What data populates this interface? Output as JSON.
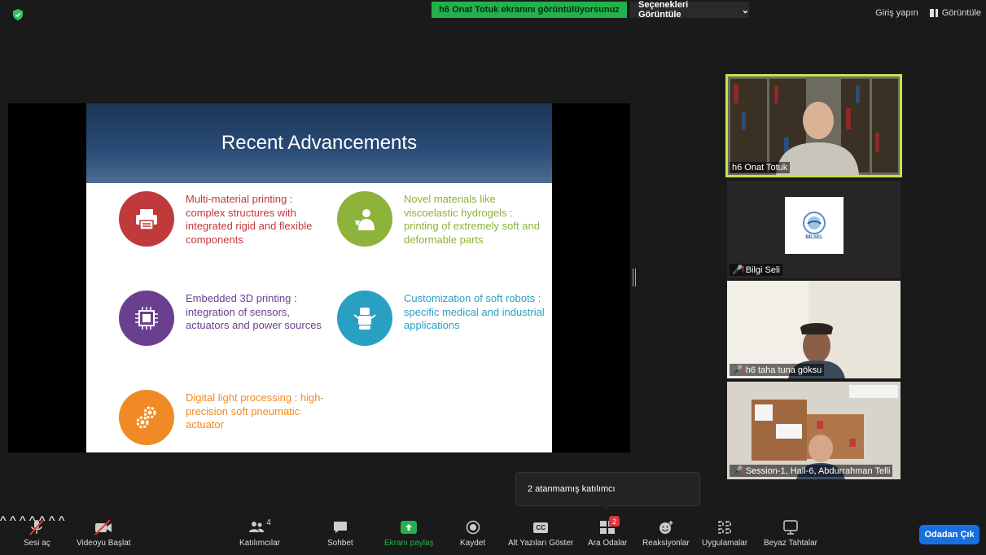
{
  "top": {
    "share_banner": "h6 Onat Totuk ekranını görüntülüyorsunuz",
    "view_options": "Seçenekleri Görüntüle",
    "sign_in": "Giriş yapın",
    "view": "Görüntüle"
  },
  "slide": {
    "title": "Recent Advancements",
    "items": [
      {
        "text": "Multi-material printing : complex structures with integrated rigid and flexible components",
        "color": "#c0393b",
        "icon": "printer-icon"
      },
      {
        "text": "Novel materials like viscoelastic hydrogels : printing of extremely soft and deformable parts",
        "color": "#8db33a",
        "icon": "scientist-icon"
      },
      {
        "text": "Embedded 3D printing : integration of sensors, actuators and power sources",
        "color": "#6b3f8f",
        "icon": "chip-icon"
      },
      {
        "text": "Customization of soft robots : specific medical and industrial applications",
        "color": "#2a9fc4",
        "icon": "robot-icon"
      },
      {
        "text": "Digital light processing : high-precision soft pneumatic actuator",
        "color": "#f08a24",
        "icon": "gears-icon"
      }
    ]
  },
  "participants": [
    {
      "name": "h6 Onat Totuk",
      "muted": false
    },
    {
      "name": "Bilgi Seli",
      "muted": true,
      "logo_text": "BİLSEL"
    },
    {
      "name": "h6 taha tuna göksu",
      "muted": true
    },
    {
      "name": "Session-1,  Hall-6, Abdurrahman Telli",
      "muted": true
    }
  ],
  "tooltip": "2 atanmamış katılımcı",
  "toolbar": {
    "unmute": "Sesi aç",
    "start_video": "Videoyu Başlat",
    "participants": "Katılımcılar",
    "participants_count": "4",
    "chat": "Sohbet",
    "share_screen": "Ekranı paylaş",
    "record": "Kaydet",
    "captions": "Alt Yazıları Göster",
    "captions_icon_text": "CC",
    "breakout": "Ara Odalar",
    "breakout_badge": "2",
    "reactions": "Reaksiyonlar",
    "apps": "Uygulamalar",
    "whiteboards": "Beyaz Tahtalar",
    "leave": "Odadan Çık"
  },
  "colors": {
    "accent": "#1670e0",
    "share_green": "#22b14c",
    "active_speaker": "#c4e34b"
  }
}
